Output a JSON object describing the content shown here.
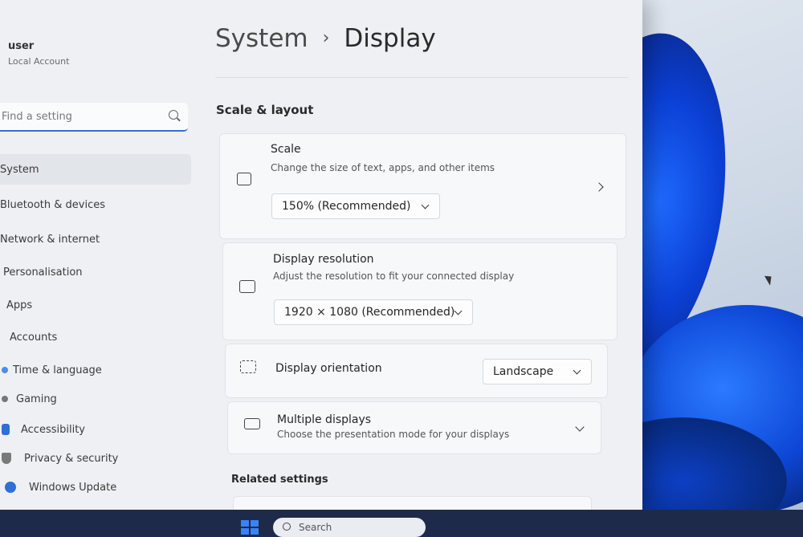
{
  "user": {
    "name": "user",
    "account_type": "Local Account"
  },
  "search": {
    "placeholder": "Find a setting"
  },
  "sidebar": {
    "items": [
      {
        "label": "System",
        "icon": "system-icon",
        "selected": true
      },
      {
        "label": "Bluetooth & devices",
        "icon": "bluetooth-icon"
      },
      {
        "label": "Network & internet",
        "icon": "network-icon"
      },
      {
        "label": "Personalisation",
        "icon": "personalisation-icon"
      },
      {
        "label": "Apps",
        "icon": "apps-icon"
      },
      {
        "label": "Accounts",
        "icon": "accounts-icon"
      },
      {
        "label": "Time & language",
        "icon": "time-language-icon"
      },
      {
        "label": "Gaming",
        "icon": "gaming-icon"
      },
      {
        "label": "Accessibility",
        "icon": "accessibility-icon"
      },
      {
        "label": "Privacy & security",
        "icon": "privacy-icon"
      },
      {
        "label": "Windows Update",
        "icon": "windows-update-icon"
      }
    ]
  },
  "breadcrumb": {
    "parent": "System",
    "separator": "›",
    "current": "Display"
  },
  "sections": {
    "scale_layout": "Scale & layout",
    "related": "Related settings"
  },
  "cards": {
    "scale": {
      "title": "Scale",
      "subtitle": "Change the size of text, apps, and other items",
      "value": "150% (Recommended)"
    },
    "resolution": {
      "title": "Display resolution",
      "subtitle": "Adjust the resolution to fit your connected display",
      "value": "1920 × 1080 (Recommended)"
    },
    "orientation": {
      "title": "Display orientation",
      "value": "Landscape"
    },
    "multiple": {
      "title": "Multiple displays",
      "subtitle": "Choose the presentation mode for your displays"
    }
  },
  "taskbar": {
    "search_label": "Search"
  },
  "colors": {
    "accent": "#3a6fd0",
    "window_bg": "#eef0f3",
    "card_bg": "#f7f8f9"
  }
}
